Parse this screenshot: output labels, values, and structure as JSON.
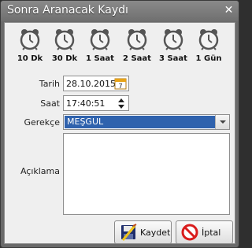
{
  "window": {
    "title": "Sonra Aranacak Kaydı",
    "close_glyph": "✕"
  },
  "alarms": [
    {
      "label": "10 Dk",
      "icon": "alarm-clock-icon"
    },
    {
      "label": "30 Dk",
      "icon": "alarm-clock-icon"
    },
    {
      "label": "1 Saat",
      "icon": "alarm-clock-icon"
    },
    {
      "label": "2 Saat",
      "icon": "alarm-clock-icon"
    },
    {
      "label": "3 Saat",
      "icon": "alarm-clock-icon"
    },
    {
      "label": "1 Gün",
      "icon": "alarm-clock-icon"
    }
  ],
  "form": {
    "date_label": "Tarih",
    "date_value": "28.10.2015",
    "calendar_day": "7",
    "time_label": "Saat",
    "time_value": "17:40:51",
    "reason_label": "Gerekçe",
    "reason_value": "MEŞGUL",
    "description_label": "Açıklama",
    "description_value": ""
  },
  "buttons": {
    "save_label": "Kaydet",
    "cancel_label": "İptal"
  },
  "colors": {
    "selection": "#2f62ad",
    "titlebar": "#757575",
    "cancel_icon": "#d91c1c"
  }
}
